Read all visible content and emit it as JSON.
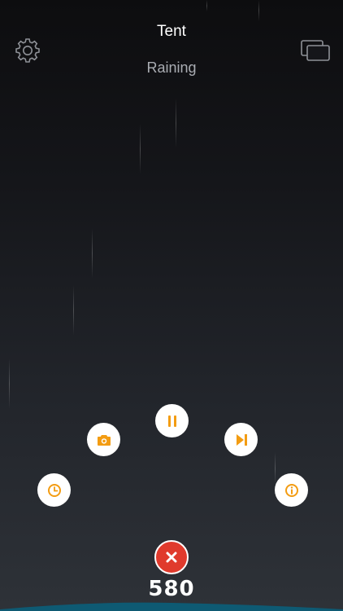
{
  "header": {
    "title": "Tent",
    "subtitle": "Raining"
  },
  "counter": {
    "value": "580"
  },
  "icons": {
    "settings": "gear-icon",
    "screens": "screens-icon",
    "pause": "pause-icon",
    "camera": "camera-icon",
    "skip": "skip-forward-icon",
    "timer": "clock-icon",
    "info": "info-icon",
    "close": "close-icon"
  },
  "colors": {
    "accent": "#f39c12",
    "close": "#e03a2c",
    "wave": "#0e5a73"
  }
}
